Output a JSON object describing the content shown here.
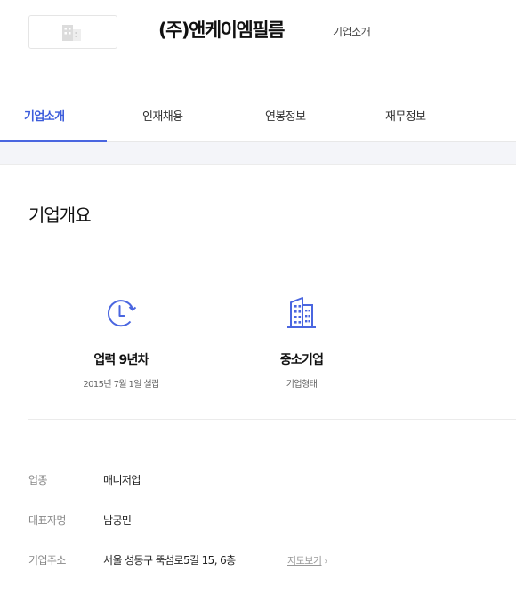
{
  "header": {
    "company_name": "(주)앤케이엠필름",
    "subtitle": "기업소개"
  },
  "tabs": [
    {
      "label": "기업소개",
      "active": true
    },
    {
      "label": "인재채용",
      "active": false
    },
    {
      "label": "연봉정보",
      "active": false
    },
    {
      "label": "재무정보",
      "active": false
    }
  ],
  "overview": {
    "title": "기업개요",
    "stats": [
      {
        "icon": "clock-icon",
        "value": "업력 9년차",
        "caption": "2015년 7월 1일 설립"
      },
      {
        "icon": "building-icon",
        "value": "중소기업",
        "caption": "기업형태"
      }
    ]
  },
  "info": {
    "industry_label": "업종",
    "industry_value": "매니저업",
    "ceo_label": "대표자명",
    "ceo_value": "남궁민",
    "address_label": "기업주소",
    "address_value": "서울 성동구 뚝섬로5길 15, 6층",
    "map_link": "지도보기"
  },
  "colors": {
    "accent": "#4a66e0",
    "divider": "#ebebeb",
    "band": "#f4f5f9"
  }
}
